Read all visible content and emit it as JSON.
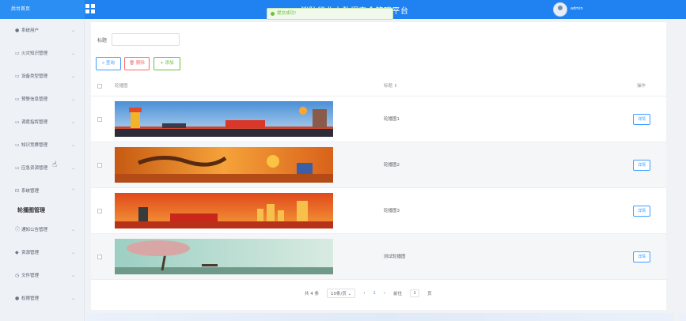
{
  "app": {
    "brand": "后台首页",
    "platform_title": "消防行业大数据安全管理平台",
    "username": "admin"
  },
  "toast": "提交成功!",
  "sidebar": {
    "items": [
      {
        "label": "系统用户",
        "icon": "user-icon"
      },
      {
        "label": "火灾知识管理",
        "icon": "folder-icon"
      },
      {
        "label": "设备类型管理",
        "icon": "folder-icon"
      },
      {
        "label": "预警信息管理",
        "icon": "folder-icon"
      },
      {
        "label": "调度指挥管理",
        "icon": "folder-icon"
      },
      {
        "label": "知识竞赛管理",
        "icon": "folder-icon"
      },
      {
        "label": "应急资源管理",
        "icon": "folder-icon"
      },
      {
        "label": "系统管理",
        "icon": "settings-icon"
      }
    ],
    "sub_item": "轮播图管理",
    "items_after": [
      {
        "label": "通知公告管理",
        "icon": "info-icon"
      },
      {
        "label": "资源管理",
        "icon": "location-icon"
      },
      {
        "label": "文件管理",
        "icon": "clock-icon"
      },
      {
        "label": "权限管理",
        "icon": "user-icon"
      }
    ]
  },
  "search": {
    "label": "标题",
    "value": ""
  },
  "toolbar": {
    "query": "查询",
    "delete": "删除",
    "add": "添加"
  },
  "table": {
    "headers": {
      "image": "轮播图",
      "title": "标题",
      "action": "操作"
    },
    "rows": [
      {
        "title": "轮播图1",
        "action": "详情"
      },
      {
        "title": "轮播图2",
        "action": "详情"
      },
      {
        "title": "轮播图3",
        "action": "详情"
      },
      {
        "title": "测试轮播图",
        "action": "详情"
      }
    ]
  },
  "pager": {
    "total": "共 4 条",
    "page_size": "10条/页",
    "current": "1",
    "goto_label": "前往",
    "goto_value": "1",
    "page_unit": "页"
  },
  "colors": {
    "primary": "#1f82f0",
    "success": "#67c23a",
    "danger": "#f56c6c"
  }
}
